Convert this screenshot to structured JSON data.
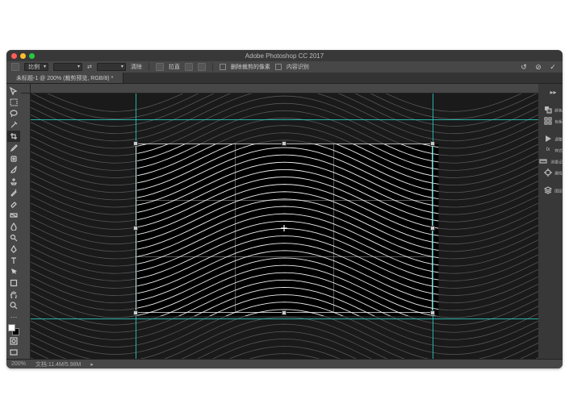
{
  "app": {
    "title": "Adobe Photoshop CC 2017"
  },
  "tab": {
    "label": "未标题-1 @ 200% (裁剪预览, RGB/8) *"
  },
  "options": {
    "ratio_label": "比例",
    "swap_label": "⇄",
    "clear_label": "清除",
    "straighten_label": "拉直",
    "delete_cropped_label": "删除裁剪的像素",
    "content_aware_label": "内容识别"
  },
  "status": {
    "zoom": "200%",
    "docinfo": "文档:11.4M/5.98M"
  },
  "panels": {
    "right": [
      {
        "icon": "square-swatch",
        "label": "颜色"
      },
      {
        "icon": "grid-swatch",
        "label": "色板"
      },
      {
        "icon": "play",
        "label": "调整"
      },
      {
        "icon": "fx",
        "label": "样式"
      },
      {
        "icon": "ruler",
        "label": "测量记录"
      },
      {
        "icon": "target",
        "label": "属性"
      },
      {
        "icon": "layers",
        "label": "图层"
      }
    ]
  },
  "guides": {
    "v": [
      130,
      498
    ],
    "h": [
      32,
      279
    ]
  },
  "colors": {
    "guide": "#2ad4c9",
    "canvas_bg": "#535353",
    "panel": "#474747"
  }
}
